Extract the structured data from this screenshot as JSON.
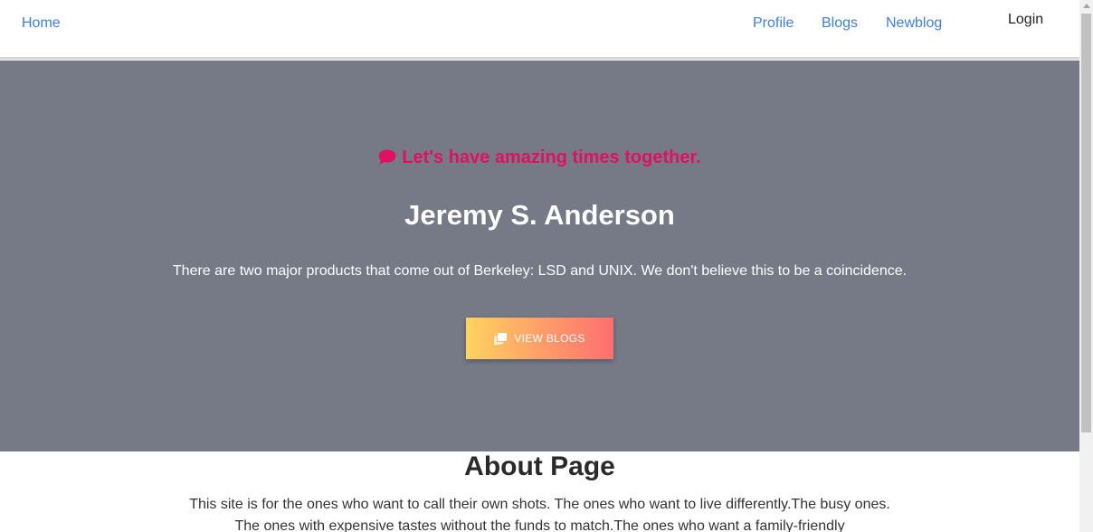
{
  "nav": {
    "home": "Home",
    "profile": "Profile",
    "blogs": "Blogs",
    "newblog": "Newblog",
    "login": "Login"
  },
  "hero": {
    "tagline": "Let's have amazing times together.",
    "tagline_icon": "comment-icon",
    "name": "Jeremy S. Anderson",
    "quote": "There are two major products that come out of Berkeley: LSD and UNIX. We don't believe this to be a coincidence.",
    "button_label": "VIEW BLOGS",
    "button_icon": "library-icon"
  },
  "about": {
    "title": "About Page",
    "lines": [
      "This site is for the ones who want to call their own shots. The ones who want to live differently.The busy ones.",
      "The ones with expensive tastes without the funds to match.The ones who want a family-friendly"
    ]
  },
  "colors": {
    "nav_link": "#3f7fd6",
    "hero_bg": "#757a86",
    "tagline": "#e0115f",
    "button_gradient_start": "#ffd35e",
    "button_gradient_end": "#ff6f6f"
  }
}
